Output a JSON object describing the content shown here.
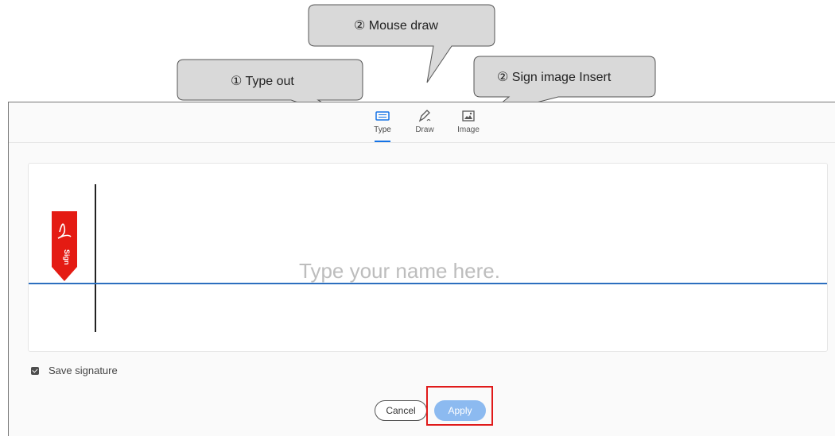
{
  "callouts": {
    "type_out": "① Type out",
    "mouse_draw": "② Mouse draw",
    "sign_image": "② Sign image  Insert"
  },
  "tabs": [
    {
      "label": "Type",
      "icon": "keyboard-icon",
      "active": true
    },
    {
      "label": "Draw",
      "icon": "pen-draw-icon",
      "active": false
    },
    {
      "label": "Image",
      "icon": "image-icon",
      "active": false
    }
  ],
  "signature": {
    "placeholder": "Type your name here.",
    "flag_text": "Sign"
  },
  "save_signature": {
    "label": "Save signature",
    "checked": true
  },
  "buttons": {
    "cancel": "Cancel",
    "apply": "Apply"
  },
  "colors": {
    "accent": "#1473e6",
    "flag_red": "#e41b13",
    "apply_disabled": "#8cbaf0",
    "highlight": "#e01a1a"
  }
}
